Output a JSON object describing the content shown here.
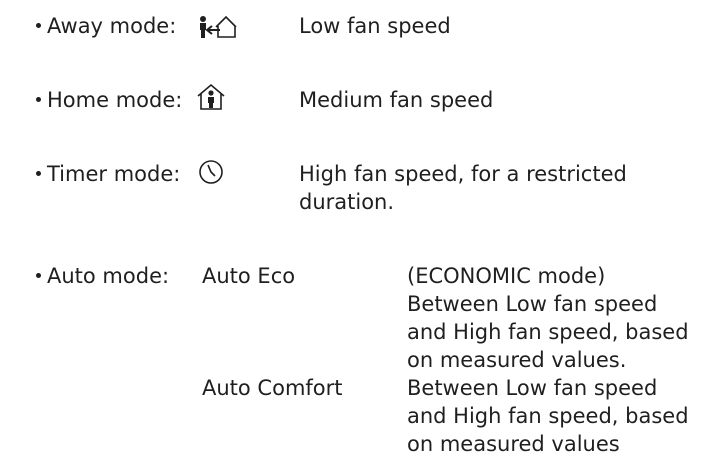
{
  "modes": [
    {
      "label": "Away mode:",
      "icon": "person-leaving-house-icon",
      "description_lines": [
        "Low fan speed"
      ]
    },
    {
      "label": "Home mode:",
      "icon": "person-in-house-icon",
      "description_lines": [
        "Medium fan speed"
      ]
    },
    {
      "label": "Timer mode:",
      "icon": "clock-icon",
      "description_lines": [
        "High fan speed, for a restricted",
        "duration."
      ]
    },
    {
      "label": "Auto mode:",
      "submodes": [
        {
          "name": "Auto Eco",
          "description_lines": [
            "(ECONOMIC mode)",
            "Between Low fan speed",
            "and High fan speed, based",
            "on measured values."
          ]
        },
        {
          "name": "Auto Comfort",
          "description_lines": [
            "Between Low fan speed",
            "and High fan speed, based",
            "on measured values"
          ]
        }
      ]
    }
  ]
}
